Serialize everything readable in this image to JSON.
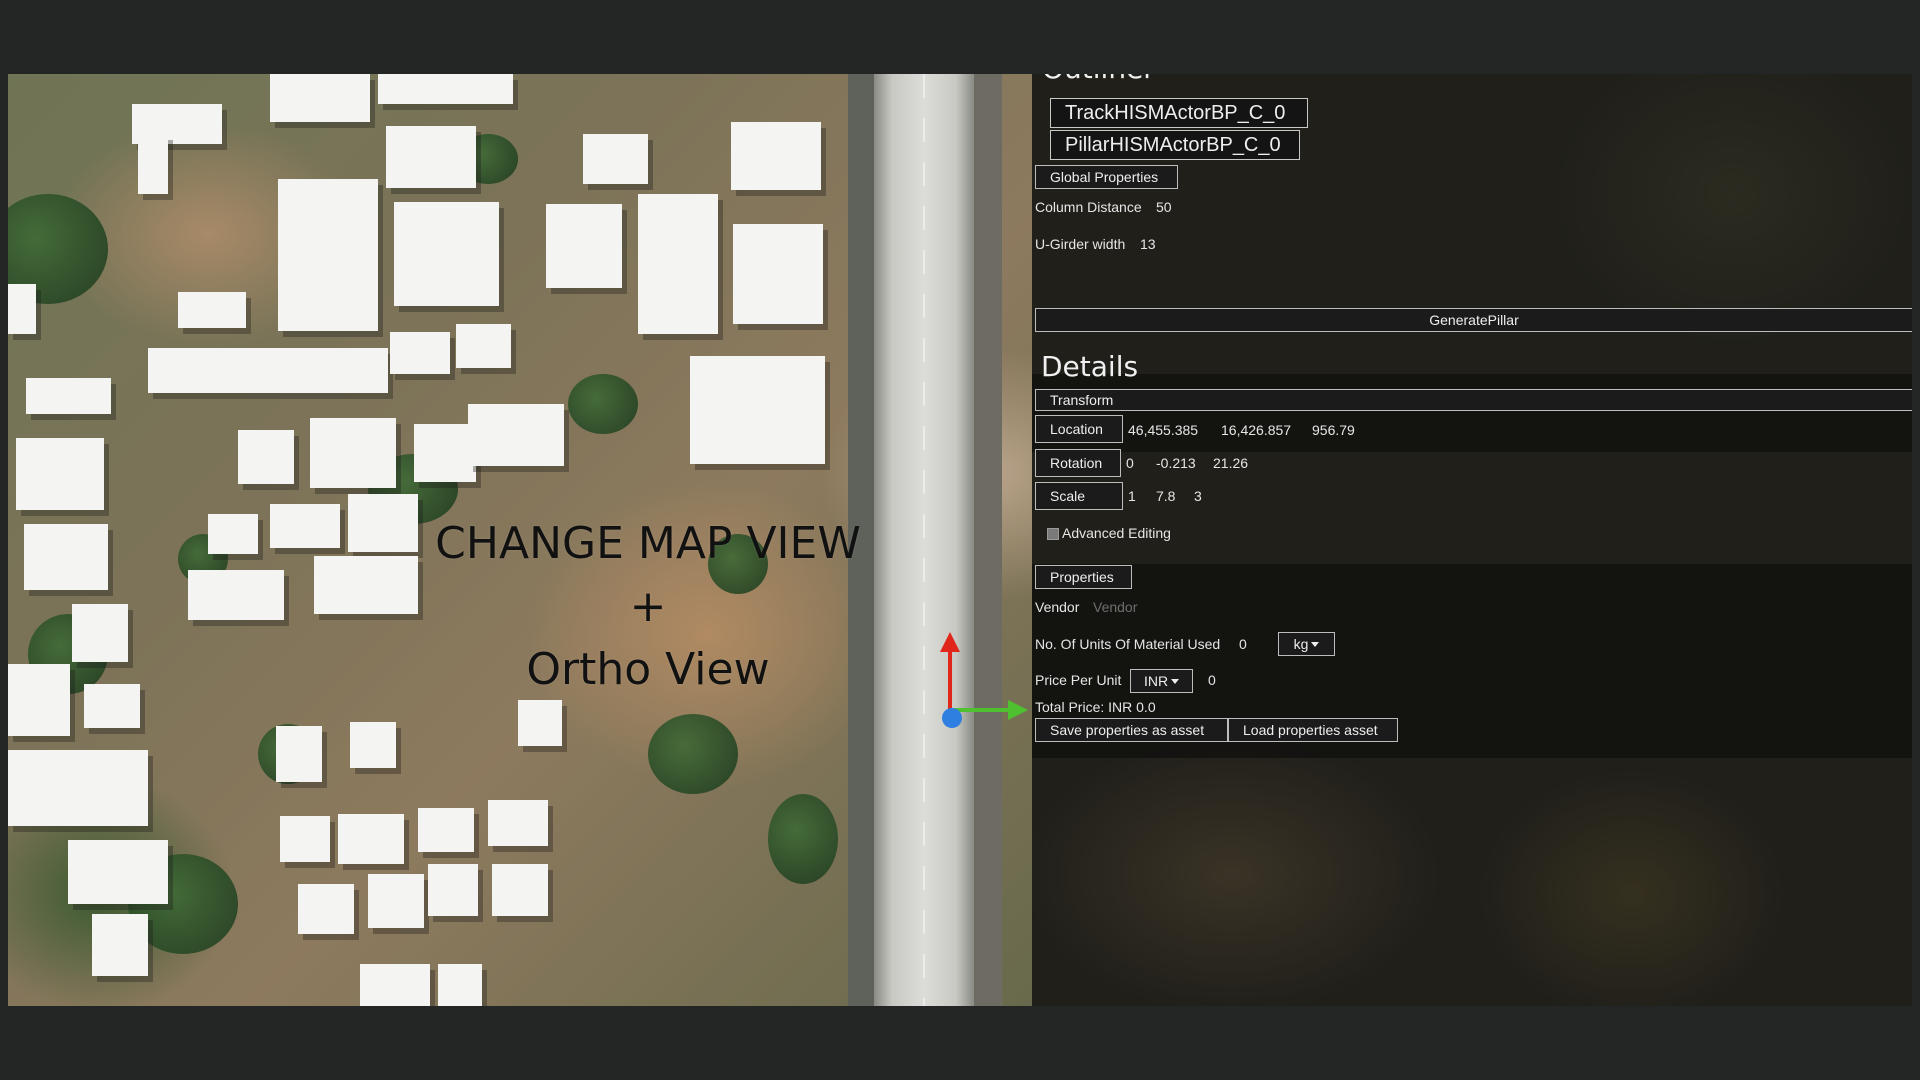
{
  "viewport": {
    "overlay_line1": "CHANGE MAP VIEW",
    "overlay_line2": "+",
    "overlay_line3": "Ortho View",
    "gizmo_colors": {
      "x_axis": "#4fc030",
      "y_axis": "#e0251b",
      "z_axis": "#2f7fe0"
    }
  },
  "outliner": {
    "title": "Outliner",
    "items": [
      "TrackHISMActorBP_C_0",
      "PillarHISMActorBP_C_0"
    ]
  },
  "global_properties": {
    "button_label": "Global Properties",
    "column_distance_label": "Column Distance",
    "column_distance_value": "50",
    "u_girder_width_label": "U-Girder width",
    "u_girder_width_value": "13",
    "generate_button": "GeneratePillar"
  },
  "details": {
    "title": "Details",
    "transform_label": "Transform",
    "location": {
      "label": "Location",
      "x": "46,455.385",
      "y": "16,426.857",
      "z": "956.79"
    },
    "rotation": {
      "label": "Rotation",
      "x": "0",
      "y": "-0.213",
      "z": "21.26"
    },
    "scale": {
      "label": "Scale",
      "x": "1",
      "y": "7.8",
      "z": "3"
    },
    "advanced_editing_label": "Advanced Editing"
  },
  "properties": {
    "button_label": "Properties",
    "vendor_label": "Vendor",
    "vendor_placeholder": "Vendor",
    "units_label": "No. Of Units Of Material Used",
    "units_value": "0",
    "units_dropdown": "kg",
    "price_label": "Price Per Unit",
    "price_dropdown": "INR",
    "price_value": "0",
    "total_price": "Total Price: INR 0.0",
    "save_button": "Save properties as asset",
    "load_button": "Load properties asset"
  }
}
